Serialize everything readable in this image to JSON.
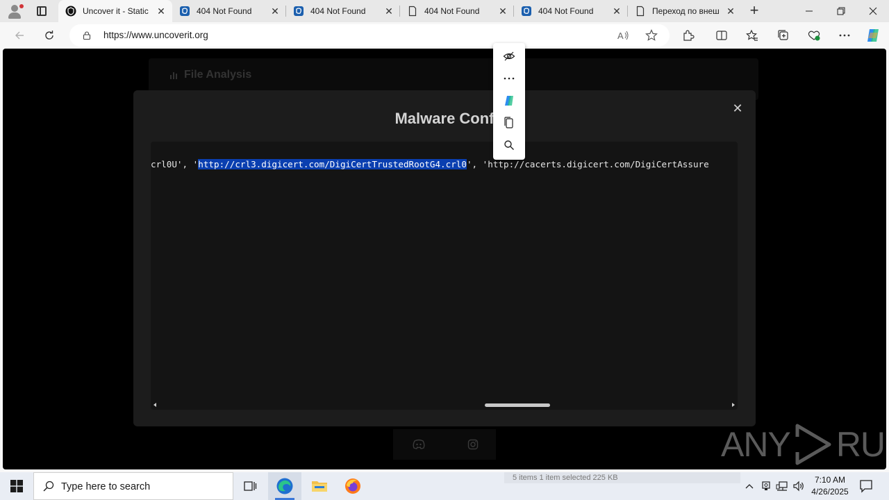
{
  "browser": {
    "tabs": [
      {
        "title": "Uncover it - Static",
        "favicon": "uncoverit-logo-icon",
        "active": true
      },
      {
        "title": "404 Not Found",
        "favicon": "tab-page-icon",
        "active": false
      },
      {
        "title": "404 Not Found",
        "favicon": "tab-page-icon",
        "active": false
      },
      {
        "title": "404 Not Found",
        "favicon": "document-icon",
        "active": false
      },
      {
        "title": "404 Not Found",
        "favicon": "tab-page-icon",
        "active": false
      },
      {
        "title": "Переход по внеш",
        "favicon": "document-icon",
        "active": false
      }
    ],
    "url": "https://www.uncoverit.org"
  },
  "page": {
    "section_title": "File Analysis",
    "modal": {
      "title": "Malware Conf",
      "code_before": "crl0U', '",
      "code_selected": "http://crl3.digicert.com/DigiCertTrustedRootG4.crl0",
      "code_after": "', 'http://cacerts.digicert.com/DigiCertAssure"
    },
    "watermark": {
      "left": "ANY",
      "right": "RUN"
    }
  },
  "selection_menu": {
    "items": [
      "hide-menu-icon",
      "more-icon",
      "copilot-icon",
      "copy-icon",
      "search-icon"
    ]
  },
  "taskbar": {
    "search_placeholder": "Type here to search",
    "explorer_status": "5 items    1 item selected  225 KB",
    "time": "7:10 AM",
    "date": "4/26/2025"
  },
  "colors": {
    "accent": "#0a3fb0",
    "modal_bg": "#1c1c1c",
    "page_bg": "#000000"
  }
}
